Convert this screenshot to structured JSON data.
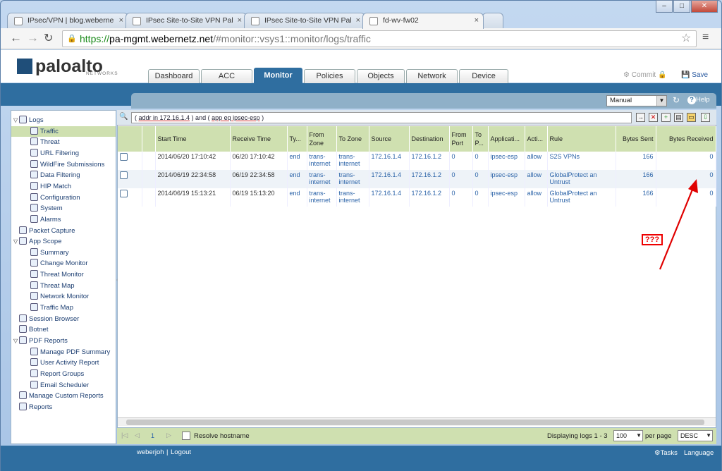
{
  "browser": {
    "tabs": [
      {
        "label": "IPsec/VPN | blog.weberne"
      },
      {
        "label": "IPsec Site-to-Site VPN Pal"
      },
      {
        "label": "IPsec Site-to-Site VPN Pal"
      },
      {
        "label": "fd-wv-fw02"
      }
    ],
    "url_scheme": "https://",
    "url_domain": "pa-mgmt.webernetz.net",
    "url_path": "/#monitor::vsys1::monitor/logs/traffic"
  },
  "app": {
    "logo_text": "paloalto",
    "logo_sub": "NETWORKS",
    "tabs": [
      "Dashboard",
      "ACC",
      "Monitor",
      "Policies",
      "Objects",
      "Network",
      "Device"
    ],
    "active_tab": "Monitor",
    "commit_label": "Commit",
    "save_label": "Save",
    "refresh_mode": "Manual",
    "help_label": "Help"
  },
  "sidebar": {
    "items": [
      {
        "label": "Logs",
        "level": 0,
        "icon": "logs-icon"
      },
      {
        "label": "Traffic",
        "level": 1,
        "icon": "traffic-icon"
      },
      {
        "label": "Threat",
        "level": 1,
        "icon": "threat-icon"
      },
      {
        "label": "URL Filtering",
        "level": 1,
        "icon": "url-filtering-icon"
      },
      {
        "label": "WildFire Submissions",
        "level": 1,
        "icon": "wildfire-icon"
      },
      {
        "label": "Data Filtering",
        "level": 1,
        "icon": "data-filtering-icon"
      },
      {
        "label": "HIP Match",
        "level": 1,
        "icon": "hip-match-icon"
      },
      {
        "label": "Configuration",
        "level": 1,
        "icon": "configuration-icon"
      },
      {
        "label": "System",
        "level": 1,
        "icon": "system-icon"
      },
      {
        "label": "Alarms",
        "level": 1,
        "icon": "alarms-icon"
      },
      {
        "label": "Packet Capture",
        "level": 0,
        "icon": "packet-capture-icon"
      },
      {
        "label": "App Scope",
        "level": 0,
        "icon": "app-scope-icon"
      },
      {
        "label": "Summary",
        "level": 1,
        "icon": "summary-icon"
      },
      {
        "label": "Change Monitor",
        "level": 1,
        "icon": "change-monitor-icon"
      },
      {
        "label": "Threat Monitor",
        "level": 1,
        "icon": "threat-monitor-icon"
      },
      {
        "label": "Threat Map",
        "level": 1,
        "icon": "threat-map-icon"
      },
      {
        "label": "Network Monitor",
        "level": 1,
        "icon": "network-monitor-icon"
      },
      {
        "label": "Traffic Map",
        "level": 1,
        "icon": "traffic-map-icon"
      },
      {
        "label": "Session Browser",
        "level": 0,
        "icon": "session-browser-icon"
      },
      {
        "label": "Botnet",
        "level": 0,
        "icon": "botnet-icon"
      },
      {
        "label": "PDF Reports",
        "level": 0,
        "icon": "pdf-reports-icon"
      },
      {
        "label": "Manage PDF Summary",
        "level": 1,
        "icon": "pdf-icon"
      },
      {
        "label": "User Activity Report",
        "level": 1,
        "icon": "user-activity-icon"
      },
      {
        "label": "Report Groups",
        "level": 1,
        "icon": "report-groups-icon"
      },
      {
        "label": "Email Scheduler",
        "level": 1,
        "icon": "email-icon"
      },
      {
        "label": "Manage Custom Reports",
        "level": 0,
        "icon": "custom-reports-icon"
      },
      {
        "label": "Reports",
        "level": 0,
        "icon": "reports-icon"
      }
    ]
  },
  "filter": {
    "prefix": "( ",
    "term1": "addr in 172.16.1.4",
    "mid": " ) and ( ",
    "term2": "app eq ipsec-esp",
    "suffix": " )"
  },
  "table": {
    "headers": [
      "",
      "",
      "Start Time",
      "Receive Time",
      "Ty...",
      "From Zone",
      "To Zone",
      "Source",
      "Destination",
      "From Port",
      "To P...",
      "Applicati...",
      "Acti...",
      "Rule",
      "Bytes Sent",
      "Bytes Received"
    ],
    "rows": [
      {
        "start": "2014/06/20 17:10:42",
        "receive": "06/20 17:10:42",
        "type": "end",
        "from_zone": "trans-internet",
        "to_zone": "trans-internet",
        "source": "172.16.1.4",
        "dest": "172.16.1.2",
        "from_port": "0",
        "to_port": "0",
        "app": "ipsec-esp",
        "action": "allow",
        "rule": "S2S VPNs",
        "sent": "166",
        "received": "0"
      },
      {
        "start": "2014/06/19 22:34:58",
        "receive": "06/19 22:34:58",
        "type": "end",
        "from_zone": "trans-internet",
        "to_zone": "trans-internet",
        "source": "172.16.1.4",
        "dest": "172.16.1.2",
        "from_port": "0",
        "to_port": "0",
        "app": "ipsec-esp",
        "action": "allow",
        "rule": "GlobalProtect an Untrust",
        "sent": "166",
        "received": "0"
      },
      {
        "start": "2014/06/19 15:13:21",
        "receive": "06/19 15:13:20",
        "type": "end",
        "from_zone": "trans-internet",
        "to_zone": "trans-internet",
        "source": "172.16.1.4",
        "dest": "172.16.1.2",
        "from_port": "0",
        "to_port": "0",
        "app": "ipsec-esp",
        "action": "allow",
        "rule": "GlobalProtect an Untrust",
        "sent": "166",
        "received": "0"
      }
    ]
  },
  "annotation": {
    "text": "???",
    "color": "#e00000"
  },
  "pager": {
    "page": "1",
    "resolve_label": "Resolve hostname",
    "displaying": "Displaying logs 1 - 3",
    "per_page_value": "100",
    "per_page_label": "per page",
    "order": "DESC"
  },
  "footer": {
    "user": "weberjoh",
    "logout": "Logout",
    "tasks": "Tasks",
    "language": "Language"
  },
  "colors": {
    "accent": "#2f6ea0",
    "header_green": "#cfe0b0",
    "link": "#2b63a8"
  }
}
